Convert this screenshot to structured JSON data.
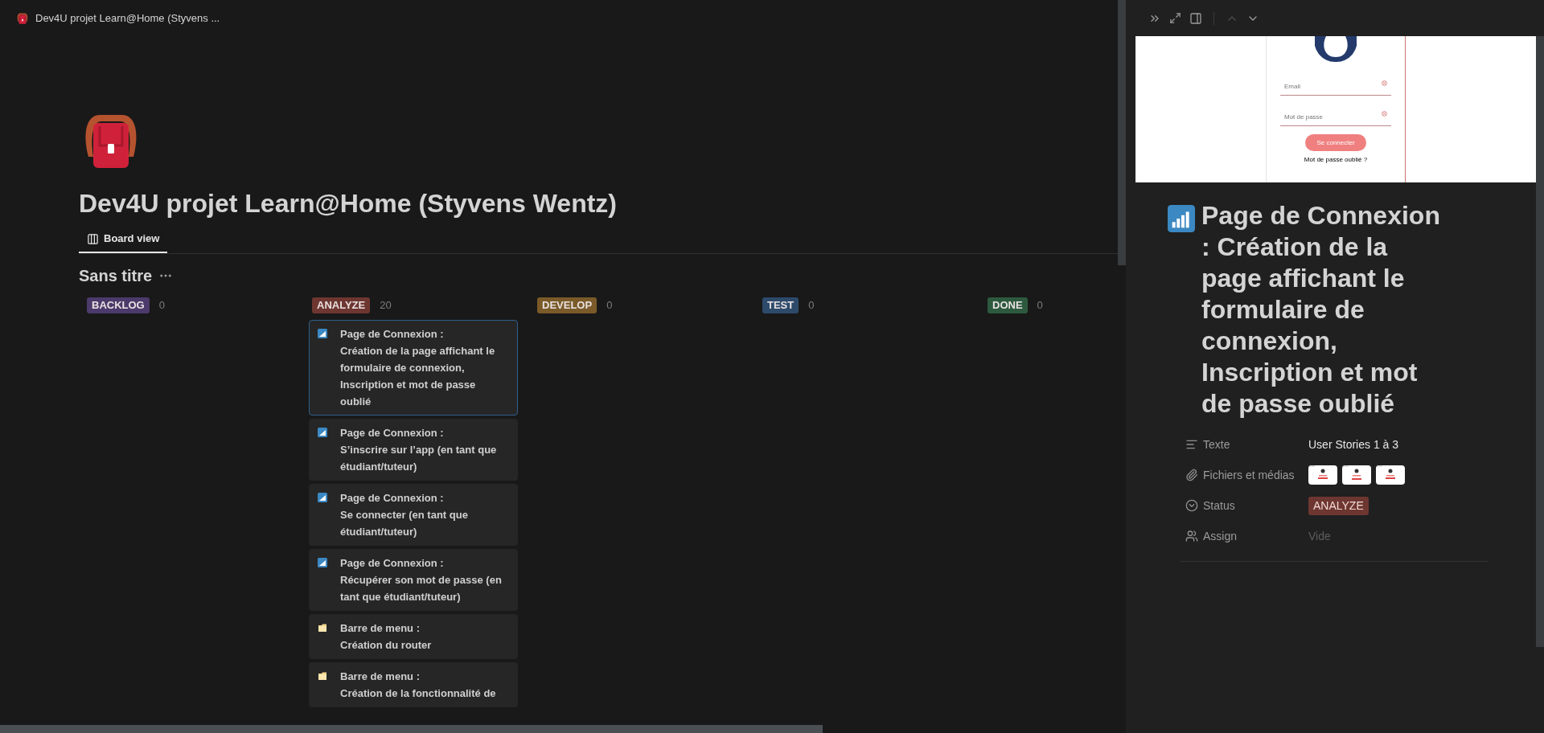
{
  "window": {
    "title": "Dev4U projet Learn@Home (Styvens ..."
  },
  "page": {
    "title": "Dev4U projet Learn@Home (Styvens Wentz)",
    "views": [
      {
        "label": "Board view",
        "selected": true
      }
    ]
  },
  "board": {
    "title": "Sans titre",
    "columns": [
      {
        "label": "BACKLOG",
        "color": "#4b3a6b",
        "count": "0"
      },
      {
        "label": "ANALYZE",
        "color": "#6e3630",
        "count": "20",
        "cards": [
          {
            "kind": "signal",
            "selected": true,
            "text": "Page de Connexion :\nCréation de la page affichant le formulaire de connexion, Inscription et mot de passe oublié"
          },
          {
            "kind": "signal",
            "selected": false,
            "text": "Page de Connexion :\nS’inscrire sur l’app (en tant que étudiant/tuteur)"
          },
          {
            "kind": "signal",
            "selected": false,
            "text": "Page de Connexion :\nSe connecter (en tant que étudiant/tuteur)"
          },
          {
            "kind": "signal",
            "selected": false,
            "text": "Page de Connexion :\nRécupérer son mot de passe (en tant que étudiant/tuteur)"
          },
          {
            "kind": "note",
            "selected": false,
            "text": "Barre de menu :\nCréation du router"
          },
          {
            "kind": "note",
            "selected": false,
            "text": "Barre de menu :\nCréation de la fonctionnalité de"
          }
        ]
      },
      {
        "label": "DEVELOP",
        "color": "#7a5a28",
        "count": "0"
      },
      {
        "label": "TEST",
        "color": "#2d4a6b",
        "count": "0"
      },
      {
        "label": "DONE",
        "color": "#2d5a3f",
        "count": "0"
      }
    ]
  },
  "detail": {
    "nav": [
      {
        "kind": "up",
        "disabled": true
      },
      {
        "kind": "down",
        "disabled": false
      }
    ],
    "cover": {
      "fields": [
        {
          "placeholder": "Email"
        },
        {
          "placeholder": "Mot de passe"
        }
      ],
      "button": "Se connecter",
      "link": "Mot de passe oublié ?"
    },
    "title": "Page de Connexion : Création de la page affichant le formulaire de connexion, Inscription et mot de passe oublié",
    "properties": [
      {
        "kind": "text",
        "label": "Texte",
        "value": "User Stories 1 à 3"
      },
      {
        "kind": "files",
        "label": "Fichiers et médias"
      },
      {
        "kind": "status",
        "label": "Status",
        "value": "ANALYZE",
        "color": "#6e3630"
      },
      {
        "kind": "person",
        "label": "Assign",
        "value": "Vide",
        "empty": true
      }
    ]
  }
}
